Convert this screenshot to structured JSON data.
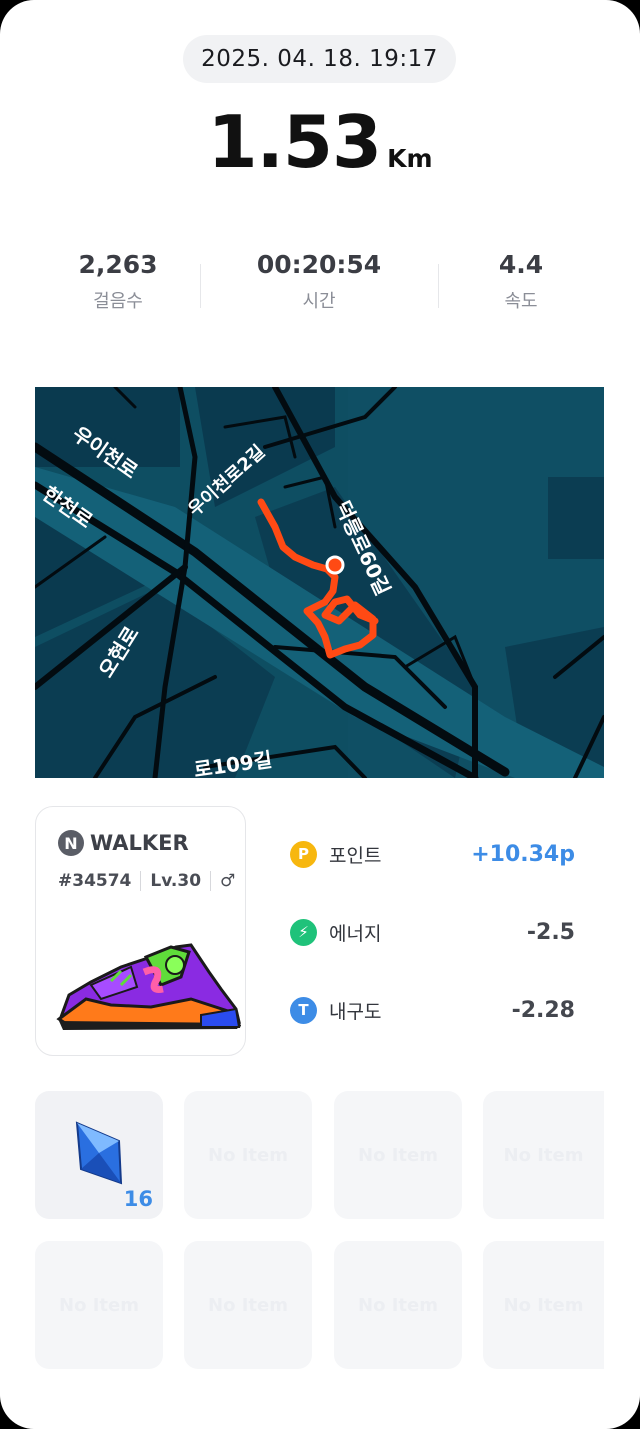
{
  "header": {
    "datetime": "2025. 04. 18. 19:17"
  },
  "distance": {
    "value": "1.53",
    "unit": "Km"
  },
  "stats": [
    {
      "value": "2,263",
      "label": "걸음수"
    },
    {
      "value": "00:20:54",
      "label": "시간"
    },
    {
      "value": "4.4",
      "label": "속도"
    }
  ],
  "map": {
    "labels": [
      "우이천로",
      "우이천로2길",
      "한천로",
      "덕릉로60길",
      "오현로",
      "로109길"
    ],
    "route_color": "#ff4a14"
  },
  "walker": {
    "brand_letter": "N",
    "brand": "WALKER",
    "id": "#34574",
    "level": "Lv.30",
    "gender_symbol": "♂"
  },
  "rewards": [
    {
      "icon": "point-icon",
      "icon_letter": "P",
      "color": "#f7b70f",
      "label": "포인트",
      "value": "+10.34p",
      "value_color": "#3d8ce6"
    },
    {
      "icon": "energy-icon",
      "icon_letter": "⚡",
      "color": "#1fc27a",
      "label": "에너지",
      "value": "-2.5"
    },
    {
      "icon": "durability-icon",
      "icon_letter": "T",
      "color": "#3d8ce6",
      "label": "내구도",
      "value": "-2.28"
    }
  ],
  "items": {
    "first": {
      "icon": "gem-icon",
      "quantity": "16"
    },
    "empty_label": "No Item"
  }
}
